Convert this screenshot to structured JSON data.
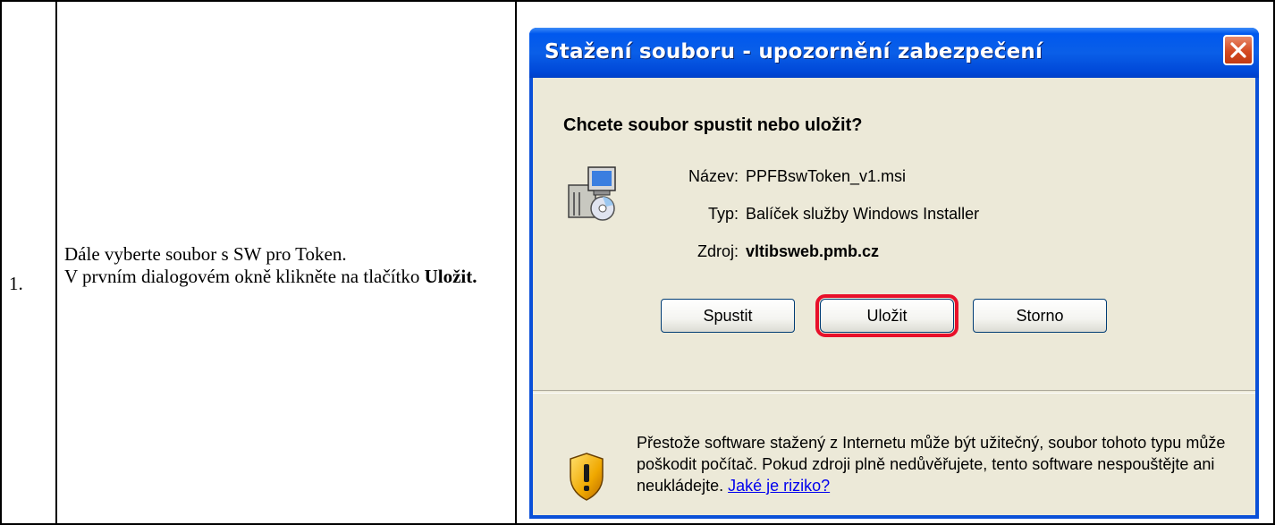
{
  "document": {
    "step_number": "1.",
    "instruction_line1": "Dále vyberte soubor s SW pro Token.",
    "instruction_line2": "V prvním dialogovém okně klikněte na tlačítko",
    "instruction_bold": "Uložit."
  },
  "dialog": {
    "title": "Stažení souboru - upozornění zabezpečení",
    "question": "Chcete soubor spustit nebo uložit?",
    "file_icon": "installer-package-icon",
    "fields": [
      {
        "label": "Název:",
        "value": "PPFBswToken_v1.msi"
      },
      {
        "label": "Typ:",
        "value": "Balíček služby Windows Installer"
      },
      {
        "label": "Zdroj:",
        "value": "vltibsweb.pmb.cz"
      }
    ],
    "buttons": {
      "run": "Spustit",
      "save": "Uložit",
      "cancel": "Storno"
    },
    "highlight_color": "#e8102a",
    "warning_icon": "warning-shield-icon",
    "warning_text": "Přestože software stažený z Internetu může být užitečný, soubor tohoto typu může poškodit počítač. Pokud zdroji plně nedůvěřujete, tento software nespouštějte ani neukládejte.",
    "warning_link": "Jaké je riziko?"
  }
}
